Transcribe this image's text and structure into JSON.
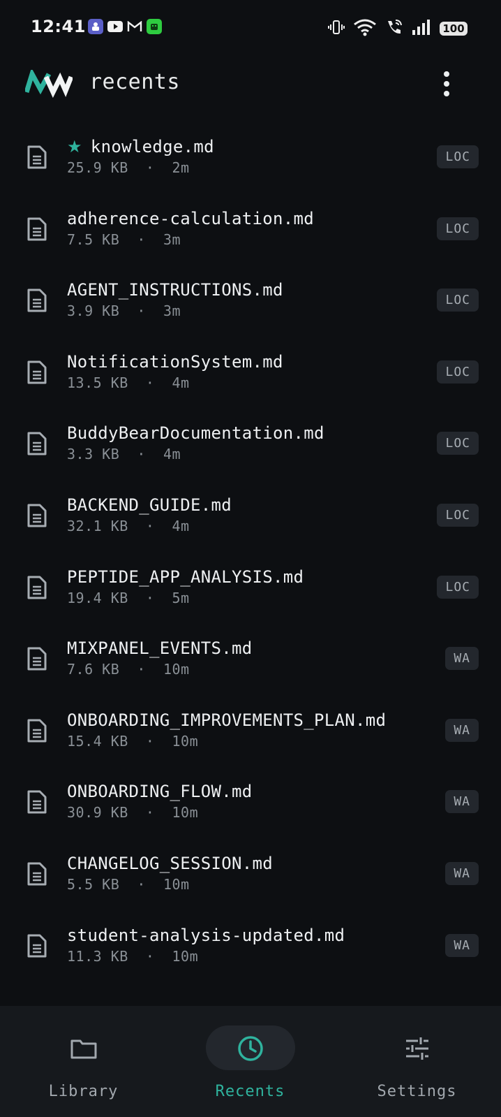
{
  "status_bar": {
    "time": "12:41",
    "battery": "100",
    "app_icons": [
      "teams-icon",
      "youtube-icon",
      "gmail-icon",
      "android-app-icon"
    ],
    "system_icons": [
      "vibrate-icon",
      "wifi-icon",
      "wifi-calling-icon",
      "signal-icon"
    ]
  },
  "app_bar": {
    "title": "recents",
    "logo": "mw-logo",
    "menu_icon": "more-vert-icon"
  },
  "colors": {
    "accent": "#2fb39e",
    "background": "#0d0f12",
    "nav_background": "#16191d"
  },
  "files": [
    {
      "name": "knowledge.md",
      "size": "25.9 KB",
      "age": "2m",
      "badge": "LOC",
      "starred": true
    },
    {
      "name": "adherence-calculation.md",
      "size": "7.5 KB",
      "age": "3m",
      "badge": "LOC",
      "starred": false
    },
    {
      "name": "AGENT_INSTRUCTIONS.md",
      "size": "3.9 KB",
      "age": "3m",
      "badge": "LOC",
      "starred": false
    },
    {
      "name": "NotificationSystem.md",
      "size": "13.5 KB",
      "age": "4m",
      "badge": "LOC",
      "starred": false
    },
    {
      "name": "BuddyBearDocumentation.md",
      "size": "3.3 KB",
      "age": "4m",
      "badge": "LOC",
      "starred": false
    },
    {
      "name": "BACKEND_GUIDE.md",
      "size": "32.1 KB",
      "age": "4m",
      "badge": "LOC",
      "starred": false
    },
    {
      "name": "PEPTIDE_APP_ANALYSIS.md",
      "size": "19.4 KB",
      "age": "5m",
      "badge": "LOC",
      "starred": false
    },
    {
      "name": "MIXPANEL_EVENTS.md",
      "size": "7.6 KB",
      "age": "10m",
      "badge": "WA",
      "starred": false
    },
    {
      "name": "ONBOARDING_IMPROVEMENTS_PLAN.md",
      "size": "15.4 KB",
      "age": "10m",
      "badge": "WA",
      "starred": false
    },
    {
      "name": "ONBOARDING_FLOW.md",
      "size": "30.9 KB",
      "age": "10m",
      "badge": "WA",
      "starred": false
    },
    {
      "name": "CHANGELOG_SESSION.md",
      "size": "5.5 KB",
      "age": "10m",
      "badge": "WA",
      "starred": false
    },
    {
      "name": "student-analysis-updated.md",
      "size": "11.3 KB",
      "age": "10m",
      "badge": "WA",
      "starred": false
    }
  ],
  "bottom_nav": [
    {
      "label": "Library",
      "icon": "folder-icon",
      "active": false
    },
    {
      "label": "Recents",
      "icon": "clock-icon",
      "active": true
    },
    {
      "label": "Settings",
      "icon": "sliders-icon",
      "active": false
    }
  ]
}
